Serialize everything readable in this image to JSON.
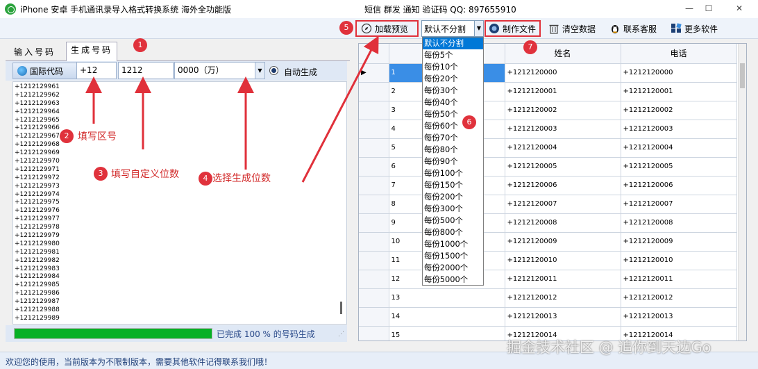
{
  "window": {
    "title": "iPhone 安卓 手机通讯录导入格式转换系统  海外全功能版",
    "title_right": "短信 群发 通知 验证码  QQ:  897655910",
    "minimize": "—",
    "maximize": "☐",
    "close": "✕"
  },
  "toolbar": {
    "load_preview": "加载预览",
    "split_value": "默认不分割",
    "make_file": "制作文件",
    "clear_data": "清空数据",
    "contact_support": "联系客服",
    "more_software": "更多软件"
  },
  "tabs": {
    "input": "输入号码",
    "generate": "生成号码"
  },
  "generate_row": {
    "code_label": "国际代码",
    "country_code": "+12",
    "custom_digits": "1212",
    "digit_select": "0000（万）",
    "auto_generate": "自动生成"
  },
  "numbers": [
    "+1212129961",
    "+1212129962",
    "+1212129963",
    "+1212129964",
    "+1212129965",
    "+1212129966",
    "+1212129967",
    "+1212129968",
    "+1212129969",
    "+1212129970",
    "+1212129971",
    "+1212129972",
    "+1212129973",
    "+1212129974",
    "+1212129975",
    "+1212129976",
    "+1212129977",
    "+1212129978",
    "+1212129979",
    "+1212129980",
    "+1212129981",
    "+1212129982",
    "+1212129983",
    "+1212129984",
    "+1212129985",
    "+1212129986",
    "+1212129987",
    "+1212129988",
    "+1212129989"
  ],
  "progress": {
    "fraction": 1.0,
    "text": "已完成 100 % 的号码生成"
  },
  "grid": {
    "headers": [
      "",
      "姓名",
      "电话"
    ],
    "rows": [
      [
        "1",
        "+1212120000",
        "+1212120000"
      ],
      [
        "2",
        "+1212120001",
        "+1212120001"
      ],
      [
        "3",
        "+1212120002",
        "+1212120002"
      ],
      [
        "4",
        "+1212120003",
        "+1212120003"
      ],
      [
        "5",
        "+1212120004",
        "+1212120004"
      ],
      [
        "6",
        "+1212120005",
        "+1212120005"
      ],
      [
        "7",
        "+1212120006",
        "+1212120006"
      ],
      [
        "8",
        "+1212120007",
        "+1212120007"
      ],
      [
        "9",
        "+1212120008",
        "+1212120008"
      ],
      [
        "10",
        "+1212120009",
        "+1212120009"
      ],
      [
        "11",
        "+1212120010",
        "+1212120010"
      ],
      [
        "12",
        "+1212120011",
        "+1212120011"
      ],
      [
        "13",
        "+1212120012",
        "+1212120012"
      ],
      [
        "14",
        "+1212120013",
        "+1212120013"
      ],
      [
        "15",
        "+1212120014",
        "+1212120014"
      ]
    ]
  },
  "dropdown_options": [
    "默认不分割",
    "每份5个",
    "每份10个",
    "每份20个",
    "每份30个",
    "每份40个",
    "每份50个",
    "每份60个",
    "每份70个",
    "每份80个",
    "每份90个",
    "每份100个",
    "每份150个",
    "每份200个",
    "每份300个",
    "每份500个",
    "每份800个",
    "每份1000个",
    "每份1500个",
    "每份2000个",
    "每份5000个"
  ],
  "annotations": {
    "b1": "1",
    "b2": "2",
    "b3": "3",
    "b4": "4",
    "b5": "5",
    "b6": "6",
    "b7": "7",
    "a2": "填写区号",
    "a3": "填写自定义位数",
    "a4": "选择生成位数"
  },
  "status": "欢迎您的使用，当前版本为不限制版本，需要其他软件记得联系我们哦！",
  "watermark": "掘金技术社区 @ 追你到天边Go",
  "colors": {
    "highlight": "#e0303a",
    "progress": "#06b025",
    "selection": "#0078d7"
  }
}
